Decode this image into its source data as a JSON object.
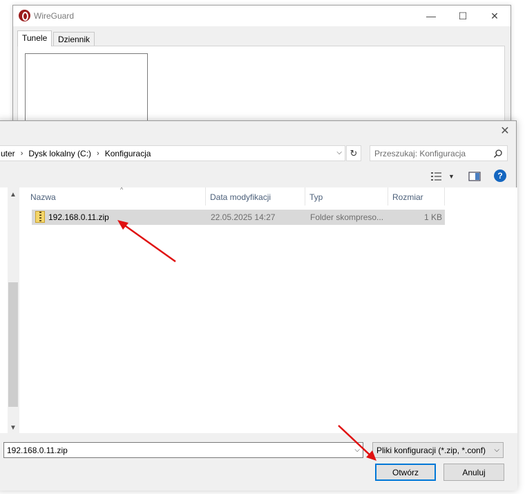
{
  "wireguard": {
    "title": "WireGuard",
    "tabs": [
      "Tunele",
      "Dziennik"
    ],
    "controls": {
      "minimize": "—",
      "maximize": "☐",
      "close": "✕"
    }
  },
  "dialog": {
    "close": "✕",
    "breadcrumb": [
      "uter",
      "Dysk lokalny (C:)",
      "Konfiguracja"
    ],
    "search_placeholder": "Przeszukaj: Konfiguracja",
    "columns": {
      "name": "Nazwa",
      "date": "Data modyfikacji",
      "type": "Typ",
      "size": "Rozmiar"
    },
    "files": [
      {
        "name": "192.168.0.11.zip",
        "date": "22.05.2025 14:27",
        "type": "Folder skompreso...",
        "size": "1 KB"
      }
    ],
    "filename_value": "192.168.0.11.zip",
    "filetype": "Pliki konfiguracji (*.zip, *.conf)",
    "buttons": {
      "open": "Otwórz",
      "cancel": "Anuluj"
    },
    "help": "?"
  },
  "colors": {
    "accent": "#0078d7",
    "selection": "#d9d9d9",
    "annotation_arrow": "#e01010",
    "header_text": "#4c607a",
    "wireguard_brand": "#9b1c1c"
  }
}
